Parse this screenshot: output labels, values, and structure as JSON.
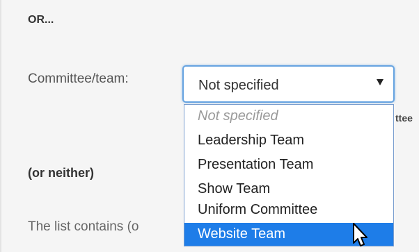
{
  "form": {
    "or_heading": "OR...",
    "committee_label": "Committee/team:",
    "hidden_behind_dropdown": "ttee",
    "or_neither": "(or neither)",
    "list_contains_label": "The list contains (o"
  },
  "select": {
    "selected_label": "Not specified",
    "arrow_icon": "caret-down-icon",
    "options": [
      {
        "label": "Not specified",
        "placeholder": true
      },
      {
        "label": "Leadership Team"
      },
      {
        "label": "Presentation Team"
      },
      {
        "label": "Show Team"
      },
      {
        "label": "Uniform Committee"
      },
      {
        "label": "Website Team",
        "highlighted": true
      }
    ]
  },
  "pointer": {
    "icon": "mouse-pointer-icon"
  },
  "colors": {
    "focus_border": "#66a3e0",
    "highlight": "#1e7de8",
    "panel_bg": "#f5f5f5"
  }
}
